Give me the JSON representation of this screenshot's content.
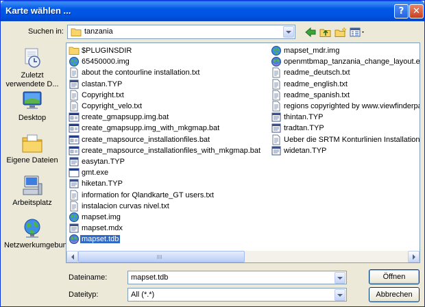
{
  "window": {
    "title": "Karte wählen ...",
    "help_label": "?",
    "close_label": "✕"
  },
  "lookin": {
    "label": "Suchen in:",
    "value": "tanzania"
  },
  "toolbar": {
    "back_icon": "back-arrow-icon",
    "up_icon": "folder-up-icon",
    "newfolder_icon": "new-folder-icon",
    "views_icon": "views-menu-icon"
  },
  "places": [
    {
      "label": "Zuletzt verwendete D...",
      "icon": "recent-documents-icon"
    },
    {
      "label": "Desktop",
      "icon": "desktop-icon"
    },
    {
      "label": "Eigene Dateien",
      "icon": "my-documents-icon"
    },
    {
      "label": "Arbeitsplatz",
      "icon": "my-computer-icon"
    },
    {
      "label": "Netzwerkumgebung",
      "icon": "network-places-icon"
    }
  ],
  "files": {
    "column1": [
      {
        "name": "$PLUGINSDIR",
        "icon": "folder"
      },
      {
        "name": "65450000.img",
        "icon": "globe"
      },
      {
        "name": "about the contourline installation.txt",
        "icon": "text"
      },
      {
        "name": "clastan.TYP",
        "icon": "typ"
      },
      {
        "name": "Copyright.txt",
        "icon": "text"
      },
      {
        "name": "Copyright_velo.txt",
        "icon": "text"
      },
      {
        "name": "create_gmapsupp.img.bat",
        "icon": "bat"
      },
      {
        "name": "create_gmapsupp.img_with_mkgmap.bat",
        "icon": "bat"
      },
      {
        "name": "create_mapsource_installationfiles.bat",
        "icon": "bat"
      },
      {
        "name": "create_mapsource_installationfiles_with_mkgmap.bat",
        "icon": "bat"
      },
      {
        "name": "easytan.TYP",
        "icon": "typ"
      },
      {
        "name": "gmt.exe",
        "icon": "exe"
      },
      {
        "name": "hiketan.TYP",
        "icon": "typ"
      },
      {
        "name": "information for Qlandkarte_GT users.txt",
        "icon": "text"
      },
      {
        "name": "instalacion curvas nivel.txt",
        "icon": "text"
      },
      {
        "name": "mapset.img",
        "icon": "globe"
      },
      {
        "name": "mapset.mdx",
        "icon": "typ"
      },
      {
        "name": "mapset.tdb",
        "icon": "globe2",
        "selected": true
      }
    ],
    "column2": [
      {
        "name": "mapset_mdr.img",
        "icon": "globe"
      },
      {
        "name": "openmtbmap_tanzania_change_layout.exe",
        "icon": "globe2"
      },
      {
        "name": "readme_deutsch.txt",
        "icon": "text"
      },
      {
        "name": "readme_english.txt",
        "icon": "text"
      },
      {
        "name": "readme_spanish.txt",
        "icon": "text"
      },
      {
        "name": "regions copyrighted by www.viewfinderpar",
        "icon": "text"
      },
      {
        "name": "thintan.TYP",
        "icon": "typ"
      },
      {
        "name": "tradtan.TYP",
        "icon": "typ"
      },
      {
        "name": "Ueber die SRTM Konturlinien Installation.txt",
        "icon": "text"
      },
      {
        "name": "widetan.TYP",
        "icon": "typ"
      }
    ]
  },
  "filename": {
    "label": "Dateiname:",
    "value": "mapset.tdb"
  },
  "filetype": {
    "label": "Dateityp:",
    "value": "All (*.*)"
  },
  "buttons": {
    "open": "Öffnen",
    "cancel": "Abbrechen"
  },
  "colors": {
    "titlebar": "#0054e3",
    "selection": "#316ac5",
    "dialog_bg": "#ece9d8"
  }
}
